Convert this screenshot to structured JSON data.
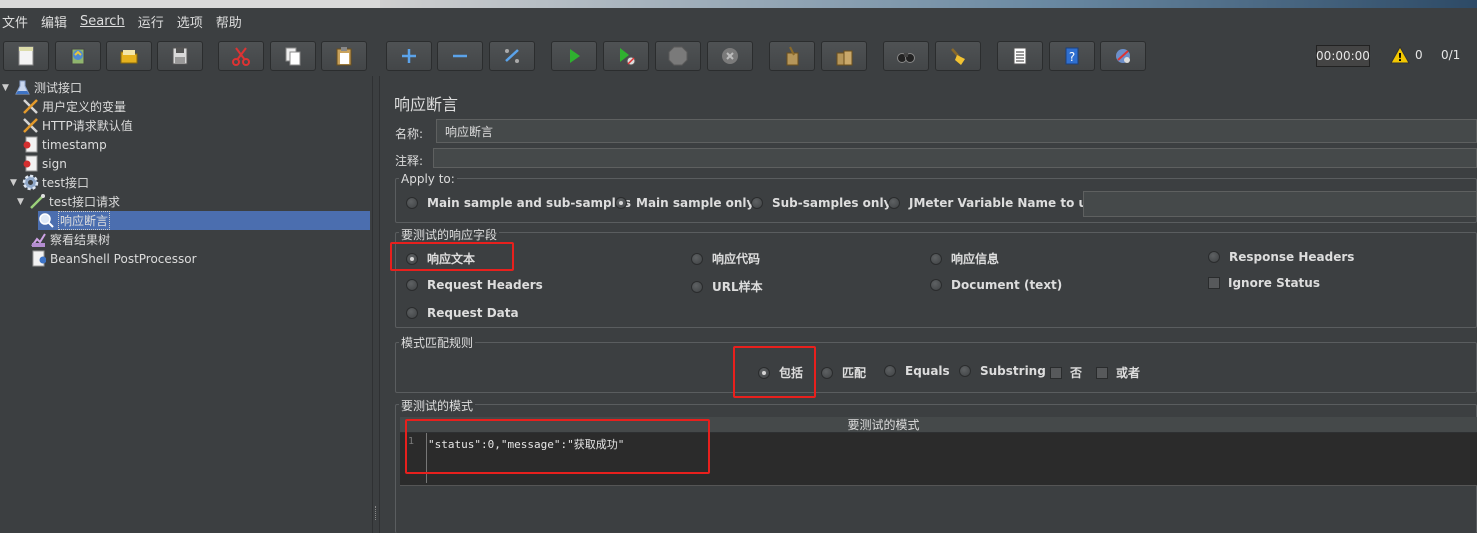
{
  "menu": [
    "文件",
    "编辑",
    "Search",
    "运行",
    "选项",
    "帮助"
  ],
  "toolbar": {
    "buttons": [
      "new-icon",
      "template-icon",
      "open-icon",
      "save-icon",
      "cut-icon",
      "copy-icon",
      "paste-icon",
      "expand-icon",
      "collapse-icon",
      "toggle-icon",
      "start-icon",
      "start-no-pause-icon",
      "stop-icon",
      "shutdown-icon",
      "clear-icon",
      "clear-all-icon",
      "search-icon",
      "reset-search-icon",
      "function-helper-icon",
      "help-icon",
      "remote-icon"
    ],
    "timer": "00:00:00",
    "warning_count": "0",
    "threads": "0/1"
  },
  "tree": [
    {
      "label": "测试接口",
      "icon": "test-plan-icon"
    },
    {
      "label": "用户定义的变量",
      "icon": "config-element-icon"
    },
    {
      "label": "HTTP请求默认值",
      "icon": "config-element-icon"
    },
    {
      "label": "timestamp",
      "icon": "beanshell-preprocessor-icon"
    },
    {
      "label": "sign",
      "icon": "beanshell-preprocessor-icon"
    },
    {
      "label": "test接口",
      "icon": "thread-group-icon"
    },
    {
      "label": "test接口请求",
      "icon": "sampler-icon"
    },
    {
      "label": "响应断言",
      "icon": "assertion-icon"
    },
    {
      "label": "察看结果树",
      "icon": "listener-icon"
    },
    {
      "label": "BeanShell PostProcessor",
      "icon": "postprocessor-icon"
    }
  ],
  "panel": {
    "title": "响应断言",
    "name_label": "名称:",
    "name_value": "响应断言",
    "comment_label": "注释:",
    "comment_value": "",
    "apply_to": {
      "title": "Apply to:",
      "options": [
        "Main sample and sub-samples",
        "Main sample only",
        "Sub-samples only",
        "JMeter Variable Name to use"
      ],
      "selected": "Main sample only"
    },
    "field_to_test": {
      "title": "要测试的响应字段",
      "options": [
        "响应文本",
        "响应代码",
        "响应信息",
        "Response Headers",
        "Request Headers",
        "URL样本",
        "Document (text)",
        "Ignore Status",
        "Request Data"
      ],
      "selected": "响应文本"
    },
    "matching_rules": {
      "title": "模式匹配规则",
      "options": [
        "包括",
        "匹配",
        "Equals",
        "Substring",
        "否",
        "或者"
      ],
      "selected": "包括"
    },
    "patterns": {
      "title": "要测试的模式",
      "column_header": "要测试的模式",
      "line_number": "1",
      "pattern": "\"status\":0,\"message\":\"获取成功\""
    }
  },
  "colors": {
    "background": "#3c3f41",
    "selection": "#4b6eaf",
    "highlight_box": "#e8201d"
  }
}
